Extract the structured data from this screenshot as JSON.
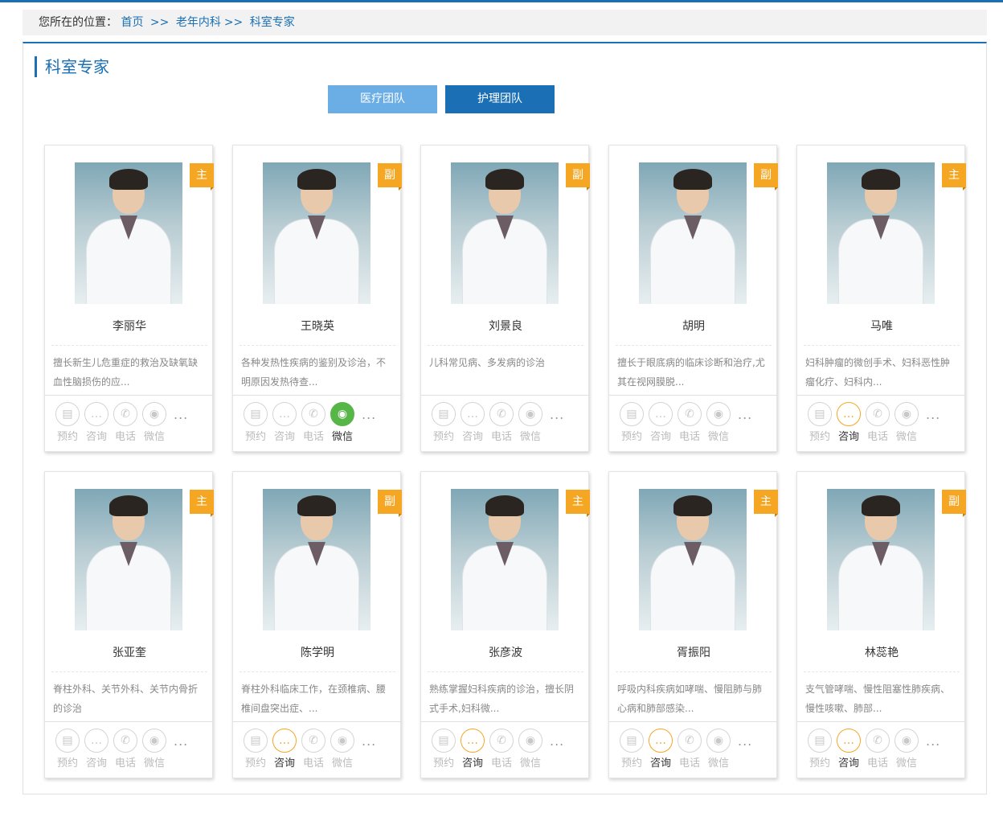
{
  "breadcrumb": {
    "prefix": "您所在的位置：",
    "home": "首页",
    "dept": "老年内科",
    "current": "科室专家",
    "sep": ">>"
  },
  "section_title": "科室专家",
  "tabs": [
    "医疗团队",
    "护理团队"
  ],
  "action_labels": [
    "预约",
    "咨询",
    "电话",
    "微信"
  ],
  "more": "...",
  "doctors": [
    {
      "name": "李丽华",
      "title": "主",
      "desc": "擅长新生儿危重症的救治及缺氧缺血性脑损伤的应...",
      "active": ""
    },
    {
      "name": "王晓英",
      "title": "副",
      "desc": "各种发热性疾病的鉴别及诊治，不明原因发热待查...",
      "active": "微信"
    },
    {
      "name": "刘景良",
      "title": "副",
      "desc": "儿科常见病、多发病的诊治",
      "active": ""
    },
    {
      "name": "胡明",
      "title": "副",
      "desc": "擅长于眼底病的临床诊断和治疗,尤其在视网膜脱...",
      "active": ""
    },
    {
      "name": "马唯",
      "title": "主",
      "desc": "妇科肿瘤的微创手术、妇科恶性肿瘤化疗、妇科内...",
      "active": "咨询"
    },
    {
      "name": "张亚奎",
      "title": "主",
      "desc": "脊柱外科、关节外科、关节内骨折的诊治",
      "active": ""
    },
    {
      "name": "陈学明",
      "title": "副",
      "desc": "脊柱外科临床工作，在颈椎病、腰椎间盘突出症、...",
      "active": "咨询"
    },
    {
      "name": "张彦波",
      "title": "主",
      "desc": "熟练掌握妇科疾病的诊治，擅长阴式手术,妇科微...",
      "active": "咨询"
    },
    {
      "name": "胥振阳",
      "title": "主",
      "desc": "呼吸内科疾病如哮喘、慢阻肺与肺心病和肺部感染...",
      "active": "咨询"
    },
    {
      "name": "林蕊艳",
      "title": "副",
      "desc": "支气管哮喘、慢性阻塞性肺疾病、慢性咳嗽、肺部...",
      "active": "咨询"
    }
  ]
}
